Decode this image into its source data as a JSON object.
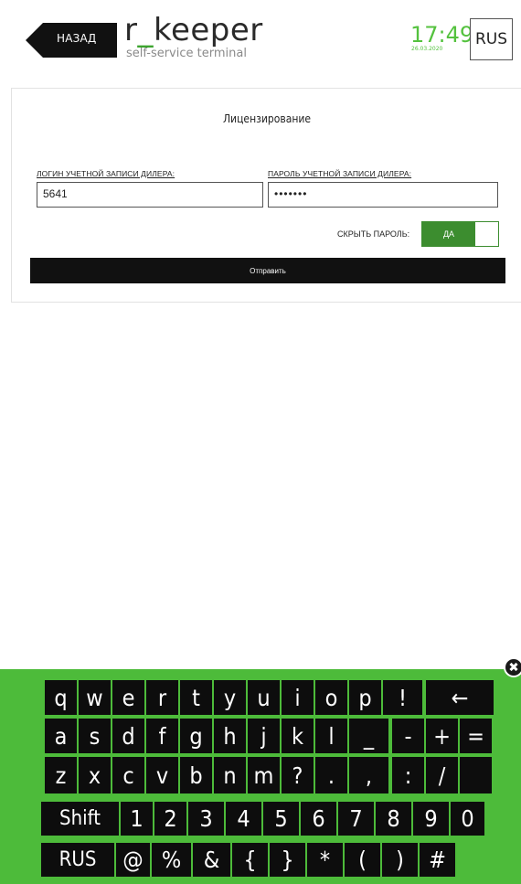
{
  "header": {
    "back_label": "НАЗАД",
    "brand_prefix": "r",
    "brand_underscore": "_",
    "brand_suffix": "keeper",
    "subtitle": "self-service terminal",
    "time": "17:49",
    "date": "26.03.2020",
    "language": "RUS"
  },
  "licensing": {
    "title": "Лицензирование",
    "login_label": "ЛОГИН УЧЕТНОЙ ЗАПИСИ ДИЛЕРА:",
    "login_value": "5641",
    "password_label": "ПАРОЛЬ УЧЕТНОЙ ЗАПИСИ ДИЛЕРА:",
    "password_value": "•••••••",
    "hide_password_label": "СКРЫТЬ ПАРОЛЬ:",
    "hide_password_state": "ДА",
    "submit_label": "Отправить"
  },
  "keyboard": {
    "rows": [
      [
        "q",
        "w",
        "e",
        "r",
        "t",
        "y",
        "u",
        "i",
        "o",
        "p",
        "!",
        "←"
      ],
      [
        "a",
        "s",
        "d",
        "f",
        "g",
        "h",
        "j",
        "k",
        "l",
        "_",
        "-",
        "+",
        "="
      ],
      [
        "z",
        "x",
        "c",
        "v",
        "b",
        "n",
        "m",
        "?",
        ".",
        ",",
        ":",
        "/",
        ""
      ],
      [
        "Shift",
        "1",
        "2",
        "3",
        "4",
        "5",
        "6",
        "7",
        "8",
        "9",
        "0"
      ],
      [
        "RUS",
        "@",
        "%",
        "&",
        "{",
        "}",
        "*",
        "(",
        ")",
        "#"
      ]
    ]
  },
  "colors": {
    "accent_green": "#4dbb3a",
    "clock_green": "#54c23e",
    "toggle_green": "#3c8d2f",
    "key_black": "#0d0d0d"
  }
}
